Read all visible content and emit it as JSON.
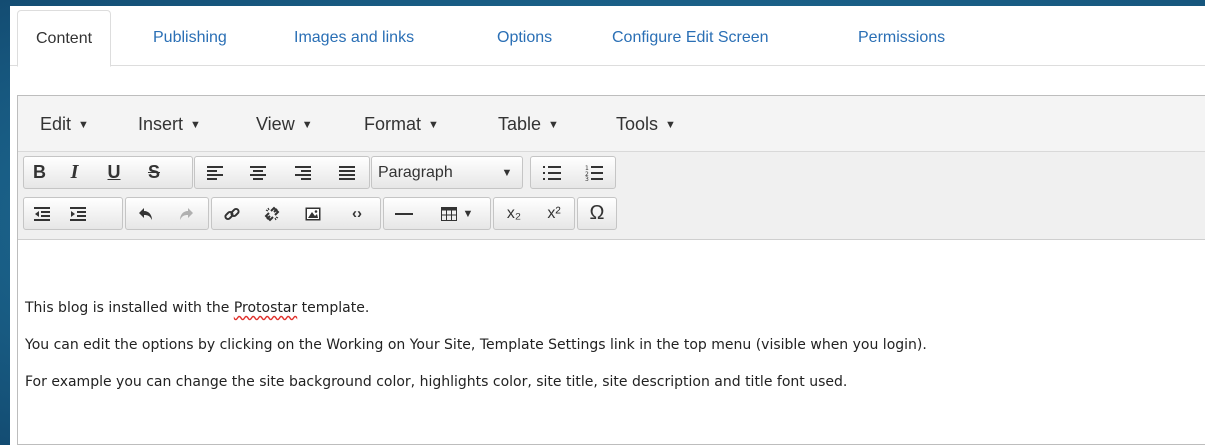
{
  "tabs": [
    {
      "label": "Content",
      "active": true
    },
    {
      "label": "Publishing"
    },
    {
      "label": "Images and links"
    },
    {
      "label": "Options"
    },
    {
      "label": "Configure Edit Screen"
    },
    {
      "label": "Permissions"
    }
  ],
  "menubar": [
    "Edit",
    "Insert",
    "View",
    "Format",
    "Table",
    "Tools"
  ],
  "toolbar": {
    "format_select": "Paragraph",
    "row1_icons": [
      "bold-icon",
      "italic-icon",
      "underline-icon",
      "strikethrough-icon",
      "align-left-icon",
      "align-center-icon",
      "align-right-icon",
      "align-justify-icon",
      "bullet-list-icon",
      "numbered-list-icon"
    ],
    "row2_icons": [
      "outdent-icon",
      "indent-icon",
      "undo-icon",
      "redo-icon",
      "link-icon",
      "unlink-icon",
      "image-icon",
      "code-icon",
      "horizontal-rule-icon",
      "table-icon",
      "subscript-icon",
      "superscript-icon",
      "special-character-icon"
    ],
    "bold": "B",
    "italic": "I",
    "underline": "U",
    "strike": "S",
    "sub": "x₂",
    "sup": "x²",
    "omega": "Ω"
  },
  "content": {
    "p1_before": "This blog is installed with the ",
    "p1_misspelled": "Protostar",
    "p1_after": " template.",
    "p2": "You can edit the options by clicking on the Working on Your Site, Template Settings link in the top menu (visible when you login).",
    "p3": "For example you can change the site background color, highlights color, site title, site description and title font used."
  }
}
